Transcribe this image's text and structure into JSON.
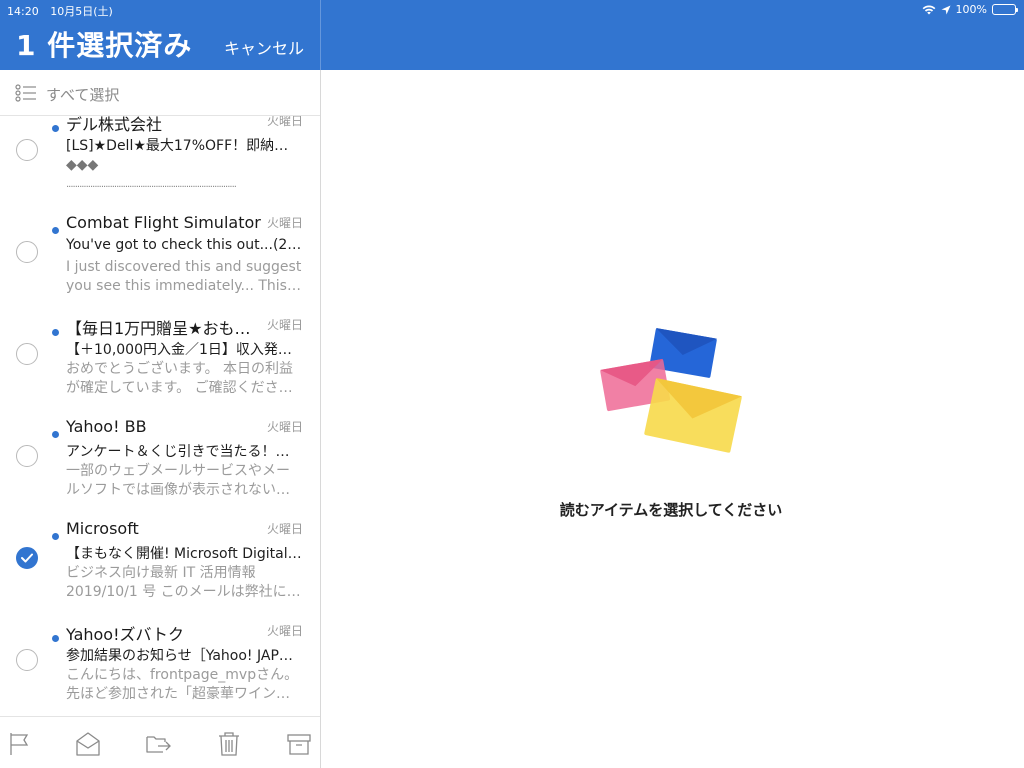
{
  "status_bar": {
    "time": "14:20",
    "date": "10月5日(土)",
    "battery": "100%",
    "battery_level": 1.0
  },
  "header": {
    "title": "1 件選択済み",
    "cancel_label": "キャンセル"
  },
  "select_all": {
    "label": "すべて選択",
    "icon": "select-list-icon"
  },
  "mails": [
    {
      "sender": "デル株式会社",
      "date": "火曜日",
      "subject": "[LS]★Dell★最大17%OFF！即納…",
      "preview1": "◆◆◆",
      "preview2": "..............................................................................",
      "unread": true,
      "selected": false
    },
    {
      "sender": "Combat Flight Simulator",
      "date": "火曜日",
      "subject": "You've got to check this out...(2…",
      "preview1": "I just discovered this and suggest",
      "preview2": "you see this immediately... This i…",
      "unread": true,
      "selected": false
    },
    {
      "sender": "【毎日1万円贈呈★おも…",
      "date": "火曜日",
      "subject": "【＋10,000円入金／1日】収入発生…",
      "preview1": "おめでとうございます。 本日の利益",
      "preview2": "が確定しています。 ご確認くださ…",
      "unread": true,
      "selected": false
    },
    {
      "sender": "Yahoo! BB",
      "date": "火曜日",
      "subject": "アンケート＆くじ引きで当たる！…",
      "preview1": "一部のウェブメールサービスやメー",
      "preview2": "ルソフトでは画像が表示されない…",
      "unread": true,
      "selected": false
    },
    {
      "sender": "Microsoft",
      "date": "火曜日",
      "subject": "【まもなく開催! Microsoft Digital…",
      "preview1": "ビジネス向け最新 IT 活用情報",
      "preview2": "2019/10/1 号 このメールは弊社に…",
      "unread": true,
      "selected": true
    },
    {
      "sender": "Yahoo!ズバトク",
      "date": "火曜日",
      "subject": "参加結果のお知らせ［Yahoo! JAP…",
      "preview1": "こんにちは、frontpage_mvpさん。",
      "preview2": "先ほど参加された「超豪華ワイン…",
      "unread": true,
      "selected": false
    }
  ],
  "toolbar": {
    "icons": [
      "flag-icon",
      "mark-read-icon",
      "move-folder-icon",
      "trash-icon",
      "archive-icon"
    ]
  },
  "reading_pane": {
    "empty_message": "読むアイテムを選択してください"
  },
  "colors": {
    "accent": "#3275d0",
    "unread_dot": "#3275d0",
    "envelope_pink": "#ee6a95",
    "envelope_blue": "#2566d8",
    "envelope_yellow": "#f7d94a"
  }
}
